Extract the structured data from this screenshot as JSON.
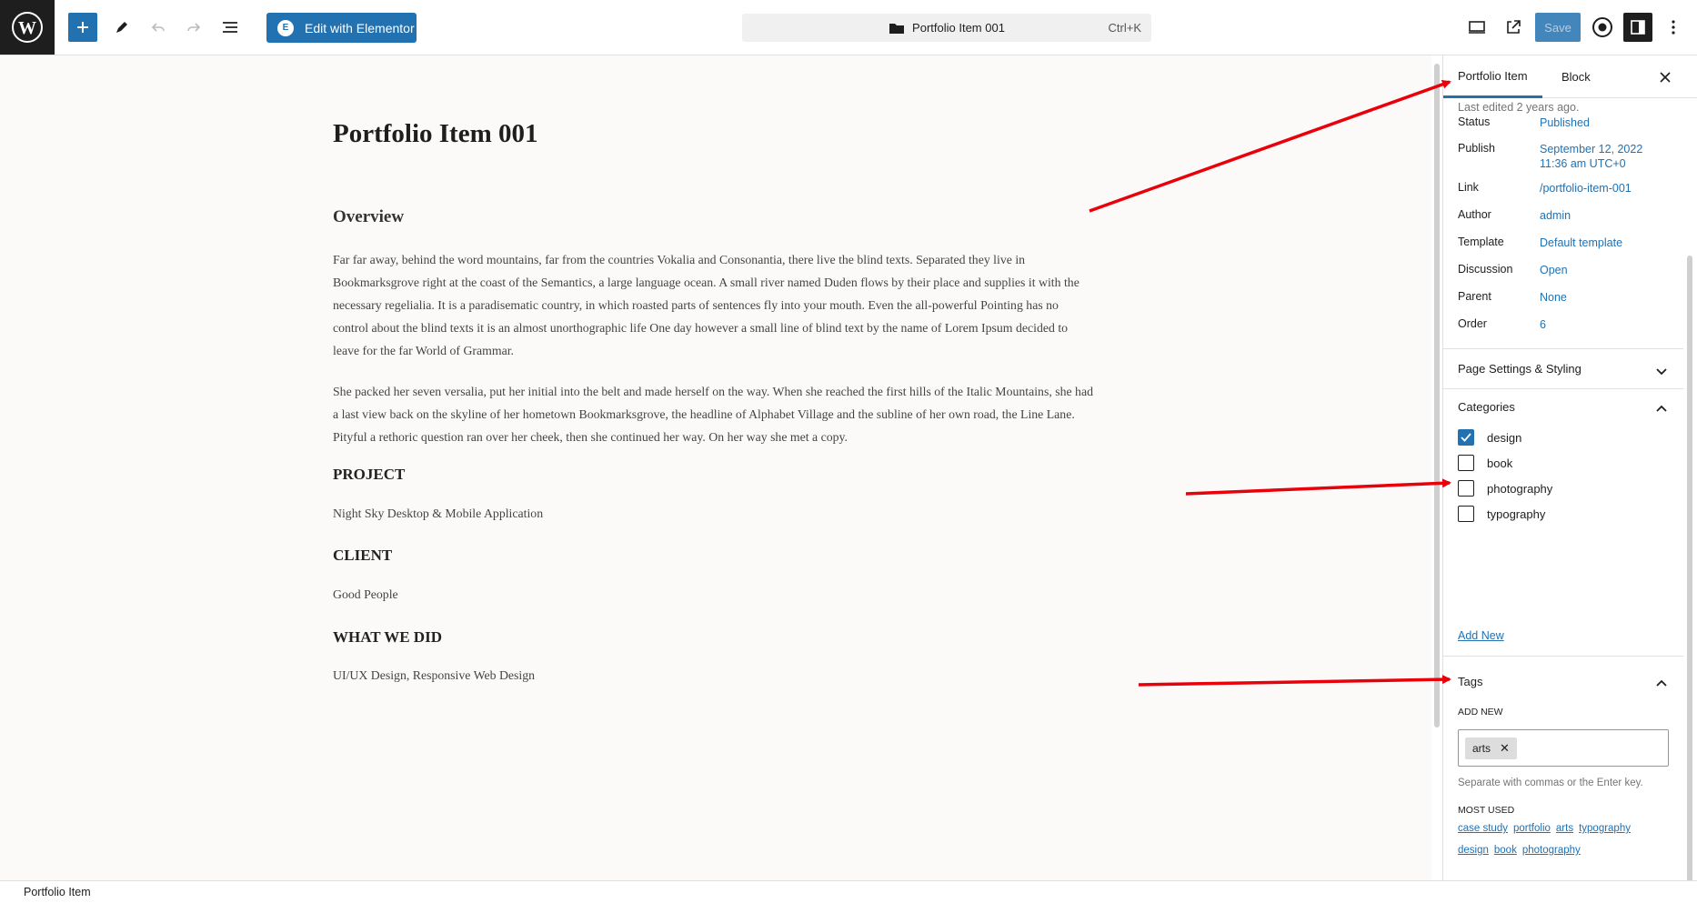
{
  "topbar": {
    "elementor_label": "Edit with Elementor",
    "command_title": "Portfolio Item 001",
    "command_shortcut": "Ctrl+K",
    "save_label": "Save"
  },
  "editor": {
    "title": "Portfolio Item 001",
    "overview_heading": "Overview",
    "paragraph1": "Far far away, behind the word mountains, far from the countries Vokalia and Consonantia, there live the blind texts. Separated they live in Bookmarksgrove right at the coast of the Semantics, a large language ocean. A small river named Duden flows by their place and supplies it with the necessary regelialia. It is a paradisematic country, in which roasted parts of sentences fly into your mouth. Even the all-powerful Pointing has no control about the blind texts it is an almost unorthographic life One day however a small line of blind text by the name of Lorem Ipsum decided to leave for the far World of Grammar.",
    "paragraph2": "She packed her seven versalia, put her initial into the belt and made herself on the way. When she reached the first hills of the Italic Mountains, she had a last view back on the skyline of her hometown Bookmarksgrove, the headline of Alphabet Village and the subline of her own road, the Line Lane. Pityful a rethoric question ran over her cheek, then she continued her way. On her way she met a copy.",
    "project_heading": "PROJECT",
    "project_text": "Night Sky Desktop & Mobile Application",
    "client_heading": "CLIENT",
    "client_text": "Good People",
    "whatwedid_heading": "WHAT WE DID",
    "whatwedid_text": "UI/UX Design, Responsive Web Design"
  },
  "sidebar": {
    "tab_item": "Portfolio Item",
    "tab_block": "Block",
    "last_edited": "Last edited 2 years ago.",
    "meta": {
      "status_label": "Status",
      "status_value": "Published",
      "publish_label": "Publish",
      "publish_value_line1": "September 12, 2022",
      "publish_value_line2": "11:36 am UTC+0",
      "link_label": "Link",
      "link_value": "/portfolio-item-001",
      "author_label": "Author",
      "author_value": "admin",
      "template_label": "Template",
      "template_value": "Default template",
      "discussion_label": "Discussion",
      "discussion_value": "Open",
      "parent_label": "Parent",
      "parent_value": "None",
      "order_label": "Order",
      "order_value": "6"
    },
    "page_settings_label": "Page Settings & Styling",
    "categories": {
      "heading": "Categories",
      "items": [
        {
          "label": "design",
          "checked": true
        },
        {
          "label": "book",
          "checked": false
        },
        {
          "label": "photography",
          "checked": false
        },
        {
          "label": "typography",
          "checked": false
        }
      ],
      "add_new": "Add New"
    },
    "tags": {
      "heading": "Tags",
      "add_new_label": "ADD NEW",
      "current_tag": "arts",
      "help": "Separate with commas or the Enter key.",
      "most_used_label": "MOST USED",
      "most_used_row1": [
        "case study",
        "portfolio",
        "arts",
        "typography"
      ],
      "most_used_row2": [
        "design",
        "book",
        "photography"
      ]
    }
  },
  "footer": {
    "breadcrumb": "Portfolio Item"
  },
  "colors": {
    "accent": "#2271b1",
    "annotation_arrow": "#e8000b"
  }
}
